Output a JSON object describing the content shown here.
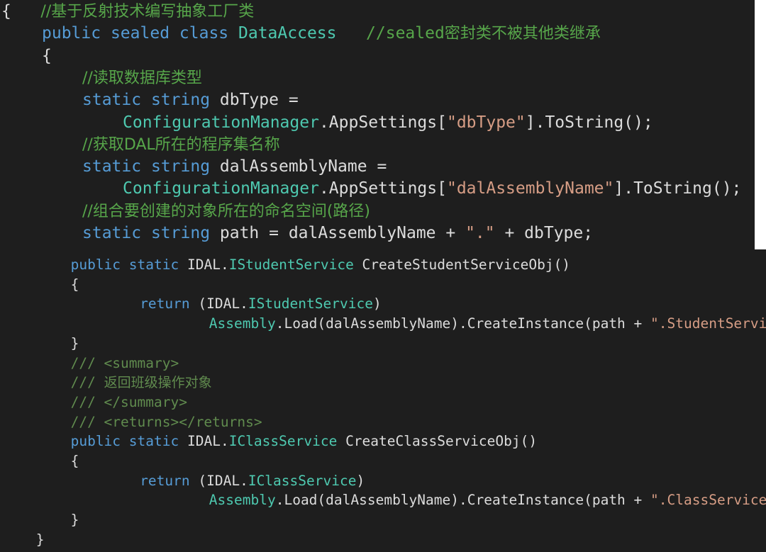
{
  "editor": {
    "panel_top": {
      "lines": [
        {
          "indent": "",
          "tokens": [
            {
              "c": "pl",
              "t": "{"
            },
            {
              "c": "pl",
              "t": "   "
            },
            {
              "c": "cm cm-cn",
              "t": "//基于反射技术编写抽象工厂类"
            }
          ]
        },
        {
          "indent": "  ",
          "tokens": [
            {
              "c": "kw",
              "t": "public"
            },
            {
              "c": "pl",
              "t": " "
            },
            {
              "c": "kw",
              "t": "sealed"
            },
            {
              "c": "pl",
              "t": " "
            },
            {
              "c": "kw",
              "t": "class"
            },
            {
              "c": "pl",
              "t": " "
            },
            {
              "c": "ty",
              "t": "DataAccess"
            },
            {
              "c": "pl",
              "t": "   "
            },
            {
              "c": "cm",
              "t": "//sealed"
            },
            {
              "c": "cm cm-cn",
              "t": "密封类不被其他类继承"
            }
          ]
        },
        {
          "indent": "  ",
          "tokens": [
            {
              "c": "pl",
              "t": "{"
            }
          ]
        },
        {
          "indent": "    ",
          "tokens": [
            {
              "c": "cm cm-cn",
              "t": "//读取数据库类型"
            }
          ]
        },
        {
          "indent": "    ",
          "tokens": [
            {
              "c": "kw",
              "t": "static"
            },
            {
              "c": "pl",
              "t": " "
            },
            {
              "c": "kw",
              "t": "string"
            },
            {
              "c": "pl",
              "t": " dbType ="
            }
          ]
        },
        {
          "indent": "      ",
          "tokens": [
            {
              "c": "ty",
              "t": "ConfigurationManager"
            },
            {
              "c": "pl",
              "t": ".AppSettings["
            },
            {
              "c": "str",
              "t": "\"dbType\""
            },
            {
              "c": "pl",
              "t": "].ToString();"
            }
          ]
        },
        {
          "indent": "    ",
          "tokens": [
            {
              "c": "cm cm-cn",
              "t": "//获取DAL所在的程序集名称"
            }
          ]
        },
        {
          "indent": "    ",
          "tokens": [
            {
              "c": "kw",
              "t": "static"
            },
            {
              "c": "pl",
              "t": " "
            },
            {
              "c": "kw",
              "t": "string"
            },
            {
              "c": "pl",
              "t": " dalAssemblyName ="
            }
          ]
        },
        {
          "indent": "      ",
          "tokens": [
            {
              "c": "ty",
              "t": "ConfigurationManager"
            },
            {
              "c": "pl",
              "t": ".AppSettings["
            },
            {
              "c": "str",
              "t": "\"dalAssemblyName\""
            },
            {
              "c": "pl",
              "t": "].ToString();"
            }
          ]
        },
        {
          "indent": "    ",
          "tokens": [
            {
              "c": "cm cm-cn",
              "t": "//组合要创建的对象所在的命名空间(路径)"
            }
          ]
        },
        {
          "indent": "    ",
          "tokens": [
            {
              "c": "kw",
              "t": "static"
            },
            {
              "c": "pl",
              "t": " "
            },
            {
              "c": "kw",
              "t": "string"
            },
            {
              "c": "pl",
              "t": " path = dalAssemblyName + "
            },
            {
              "c": "str",
              "t": "\".\""
            },
            {
              "c": "pl",
              "t": " + dbType;"
            }
          ]
        }
      ]
    },
    "panel_bottom": {
      "lines": [
        {
          "indent": "    ",
          "tokens": [
            {
              "c": "kw",
              "t": "public"
            },
            {
              "c": "pl",
              "t": " "
            },
            {
              "c": "kw",
              "t": "static"
            },
            {
              "c": "pl",
              "t": " IDAL."
            },
            {
              "c": "ty",
              "t": "IStudentService"
            },
            {
              "c": "pl",
              "t": " CreateStudentServiceObj()"
            }
          ]
        },
        {
          "indent": "    ",
          "tokens": [
            {
              "c": "pl",
              "t": "{"
            }
          ]
        },
        {
          "indent": "        ",
          "tokens": [
            {
              "c": "kw",
              "t": "return"
            },
            {
              "c": "pl",
              "t": " (IDAL."
            },
            {
              "c": "ty",
              "t": "IStudentService"
            },
            {
              "c": "pl",
              "t": ")"
            }
          ]
        },
        {
          "indent": "            ",
          "tokens": [
            {
              "c": "ty",
              "t": "Assembly"
            },
            {
              "c": "pl",
              "t": ".Load(dalAssemblyName).CreateInstance(path + "
            },
            {
              "c": "str",
              "t": "\".StudentService\""
            },
            {
              "c": "pl",
              "t": ");"
            }
          ]
        },
        {
          "indent": "    ",
          "tokens": [
            {
              "c": "pl",
              "t": "}"
            }
          ]
        },
        {
          "indent": "    ",
          "tokens": [
            {
              "c": "xd",
              "t": "/// <summary>"
            }
          ]
        },
        {
          "indent": "    ",
          "tokens": [
            {
              "c": "xd",
              "t": "/// "
            },
            {
              "c": "xd cm-cn",
              "t": "返回班级操作对象"
            }
          ]
        },
        {
          "indent": "    ",
          "tokens": [
            {
              "c": "xd",
              "t": "/// </summary>"
            }
          ]
        },
        {
          "indent": "    ",
          "tokens": [
            {
              "c": "xd",
              "t": "/// <returns></returns>"
            }
          ]
        },
        {
          "indent": "    ",
          "tokens": [
            {
              "c": "kw",
              "t": "public"
            },
            {
              "c": "pl",
              "t": " "
            },
            {
              "c": "kw",
              "t": "static"
            },
            {
              "c": "pl",
              "t": " IDAL."
            },
            {
              "c": "ty",
              "t": "IClassService"
            },
            {
              "c": "pl",
              "t": " CreateClassServiceObj()"
            }
          ]
        },
        {
          "indent": "    ",
          "tokens": [
            {
              "c": "pl",
              "t": "{"
            }
          ]
        },
        {
          "indent": "        ",
          "tokens": [
            {
              "c": "kw",
              "t": "return"
            },
            {
              "c": "pl",
              "t": " (IDAL."
            },
            {
              "c": "ty",
              "t": "IClassService"
            },
            {
              "c": "pl",
              "t": ")"
            }
          ]
        },
        {
          "indent": "            ",
          "tokens": [
            {
              "c": "ty",
              "t": "Assembly"
            },
            {
              "c": "pl",
              "t": ".Load(dalAssemblyName).CreateInstance(path + "
            },
            {
              "c": "str",
              "t": "\".ClassService\""
            },
            {
              "c": "pl",
              "t": ");"
            }
          ]
        },
        {
          "indent": "    ",
          "tokens": [
            {
              "c": "pl",
              "t": "}"
            }
          ]
        },
        {
          "indent": "  ",
          "tokens": [
            {
              "c": "pl",
              "t": "}"
            }
          ]
        }
      ]
    },
    "colors": {
      "background": "#1e1e1e",
      "keyword": "#569cd6",
      "type": "#4ec9b0",
      "string": "#d69d85",
      "comment": "#57a64a",
      "plain": "#dcdcdc",
      "highlight_line": "#0f0f0f"
    }
  }
}
